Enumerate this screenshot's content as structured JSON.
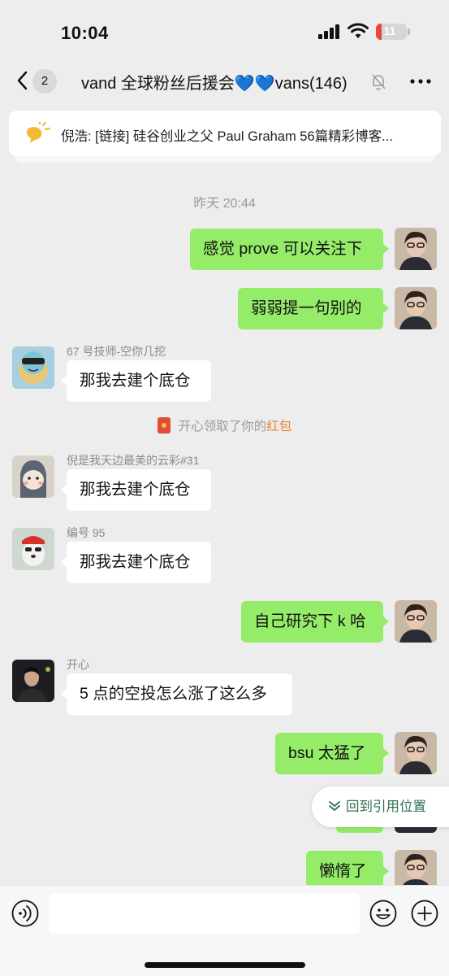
{
  "status_bar": {
    "time": "10:04",
    "battery": "11",
    "battery_level_percent": 11
  },
  "header": {
    "unread_count": "2",
    "title": "vand 全球粉丝后援会💙💙vans(146)"
  },
  "pinned": {
    "text": "倪浩: [链接] 硅谷创业之父 Paul Graham 56篇精彩博客..."
  },
  "timestamp": "昨天 20:44",
  "messages": {
    "m1": {
      "text": "感觉 prove 可以关注下"
    },
    "m2": {
      "text": "弱弱提一句别的"
    },
    "m3": {
      "sender": "67 号技师-空你几挖",
      "text": "那我去建个底仓"
    },
    "system": {
      "prefix": "开心领取了你的",
      "link": "红包"
    },
    "m4": {
      "sender": "倪是我天边最美的云彩#31",
      "text": "那我去建个底仓"
    },
    "m5": {
      "sender": "编号 95",
      "text": "那我去建个底仓"
    },
    "m6": {
      "text": "自己研究下 k 哈"
    },
    "m7": {
      "sender": "开心",
      "text": "5 点的空投怎么涨了这么多"
    },
    "m8": {
      "text": "bsu 太猛了"
    },
    "m9": {
      "text": "懒惰了"
    }
  },
  "quote_button": {
    "label": "回到引用位置"
  },
  "input": {
    "value": "",
    "placeholder": ""
  },
  "colors": {
    "my_bubble": "#95ec69",
    "other_bubble": "#ffffff",
    "background": "#ededed",
    "red_packet_link": "#e9812d"
  }
}
